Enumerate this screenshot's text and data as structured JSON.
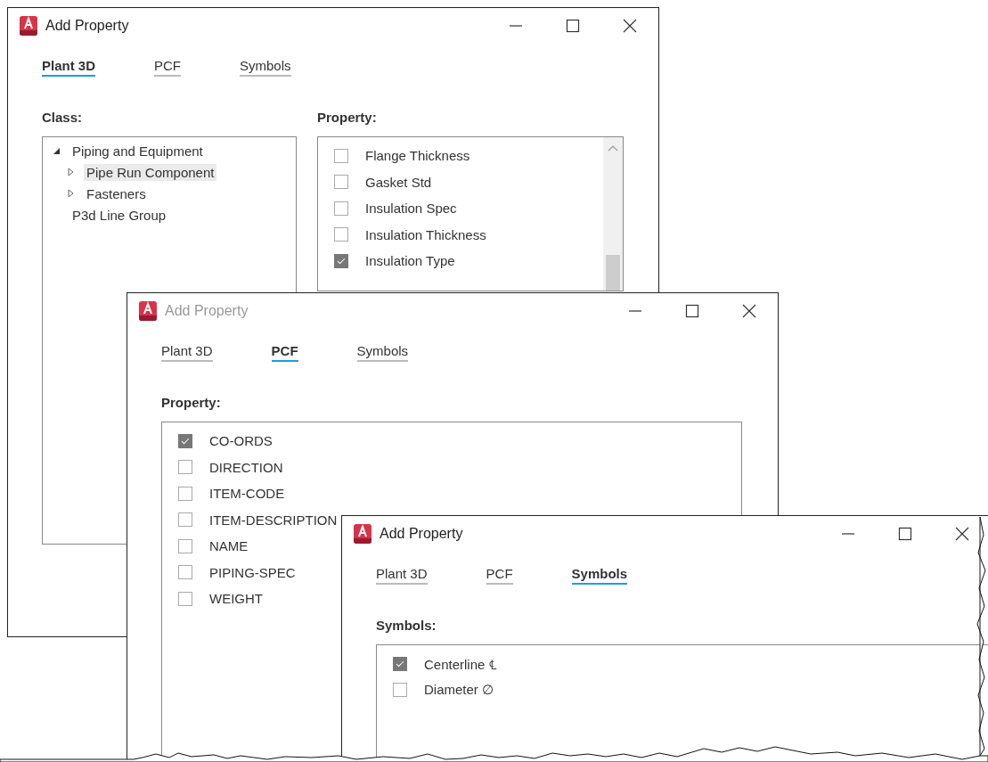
{
  "windows": [
    {
      "title": "Add Property",
      "active": true,
      "tabs": [
        {
          "label": "Plant 3D",
          "selected": true
        },
        {
          "label": "PCF",
          "selected": false
        },
        {
          "label": "Symbols",
          "selected": false
        }
      ],
      "panels": [
        {
          "kind": "tree",
          "label": "Class:",
          "items": [
            {
              "label": "Piping and Equipment",
              "expanded": true,
              "selected": false,
              "children": [
                {
                  "label": "Pipe Run Component",
                  "expanded": false,
                  "selected": true
                },
                {
                  "label": "Fasteners",
                  "expanded": false,
                  "selected": false
                }
              ]
            },
            {
              "label": "P3d Line Group",
              "selected": false
            }
          ]
        },
        {
          "kind": "checklist",
          "label": "Property:",
          "scrollbar": true,
          "items": [
            {
              "label": "Flange Thickness",
              "checked": false
            },
            {
              "label": "Gasket Std",
              "checked": false
            },
            {
              "label": "Insulation Spec",
              "checked": false
            },
            {
              "label": "Insulation Thickness",
              "checked": false
            },
            {
              "label": "Insulation Type",
              "checked": true
            }
          ]
        }
      ]
    },
    {
      "title": "Add Property",
      "active": false,
      "tabs": [
        {
          "label": "Plant 3D",
          "selected": false
        },
        {
          "label": "PCF",
          "selected": true
        },
        {
          "label": "Symbols",
          "selected": false
        }
      ],
      "panels": [
        {
          "kind": "checklist",
          "label": "Property:",
          "items": [
            {
              "label": "CO-ORDS",
              "checked": true
            },
            {
              "label": "DIRECTION",
              "checked": false
            },
            {
              "label": "ITEM-CODE",
              "checked": false
            },
            {
              "label": "ITEM-DESCRIPTION",
              "checked": false
            },
            {
              "label": "NAME",
              "checked": false
            },
            {
              "label": "PIPING-SPEC",
              "checked": false
            },
            {
              "label": "WEIGHT",
              "checked": false
            }
          ]
        }
      ]
    },
    {
      "title": "Add Property",
      "active": true,
      "tabs": [
        {
          "label": "Plant 3D",
          "selected": false
        },
        {
          "label": "PCF",
          "selected": false
        },
        {
          "label": "Symbols",
          "selected": true
        }
      ],
      "panels": [
        {
          "kind": "checklist",
          "label": "Symbols:",
          "items": [
            {
              "label": "Centerline ℄",
              "checked": true
            },
            {
              "label": "Diameter ∅",
              "checked": false
            }
          ]
        }
      ]
    }
  ]
}
